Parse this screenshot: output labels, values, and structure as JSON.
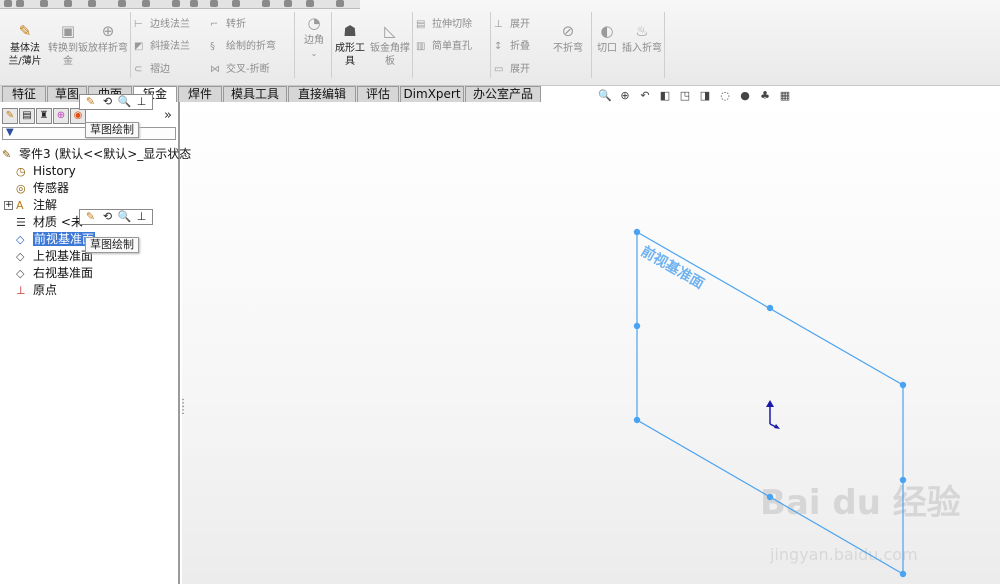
{
  "ribbon": {
    "base_flange": "基体法兰/薄片",
    "convert_to_sheet": "转换到钣金",
    "lofted_bend": "放样折弯",
    "edge_flange": "边线法兰",
    "miter_flange": "斜接法兰",
    "hem": "褶边",
    "jog": "转折",
    "sketched_bend": "绘制的折弯",
    "cross_break": "交叉-折断",
    "corner": "边角",
    "forming_tool": "成形工具",
    "gusset": "钣金角撑板",
    "extruded_cut": "拉伸切除",
    "simple_hole": "简单直孔",
    "unfold": "展开",
    "fold": "折叠",
    "flatten": "展开",
    "no_bends": "不折弯",
    "rip": "切口",
    "insert_bends": "插入折弯"
  },
  "tabs": [
    "特征",
    "草图",
    "曲面",
    "钣金",
    "焊件",
    "模具工具",
    "直接编辑",
    "评估",
    "DimXpert",
    "办公室产品"
  ],
  "tree": {
    "root": "零件3 (默认<<默认>_显示状态",
    "history": "History",
    "sensors": "传感器",
    "annotations": "注解",
    "material": "材质 <未",
    "front_plane": "前视基准面",
    "top_plane": "上视基准面",
    "right_plane": "右视基准面",
    "origin": "原点"
  },
  "context_toolbar": {
    "tooltip": "草图绘制"
  },
  "viewport": {
    "plane_label": "前视基准面",
    "plane_color": "#4aa3f0",
    "watermark": "Bai du 经验",
    "watermark_url": "jingyan.baidu.com"
  },
  "colors": {
    "annotation_arrow": "#ee4444",
    "selection": "#3c78d8"
  }
}
